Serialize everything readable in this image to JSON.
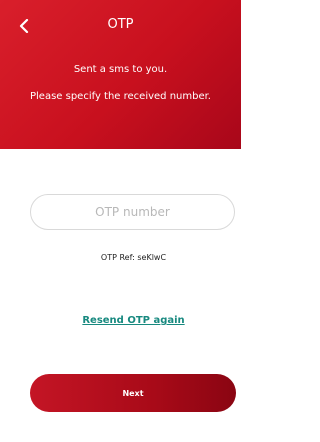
{
  "header": {
    "title": "OTP",
    "message_line1": "Sent a sms to you.",
    "message_line2": "Please specify the received number.",
    "back_icon": "chevron-left-icon",
    "background_color": "#c8101e"
  },
  "form": {
    "otp_placeholder": "OTP number",
    "otp_value": "",
    "otp_ref": "OTP Ref: seKlwC",
    "resend_link": "Resend OTP again",
    "next_button": "Next"
  },
  "colors": {
    "accent": "#c8101e",
    "link": "#17897f"
  }
}
